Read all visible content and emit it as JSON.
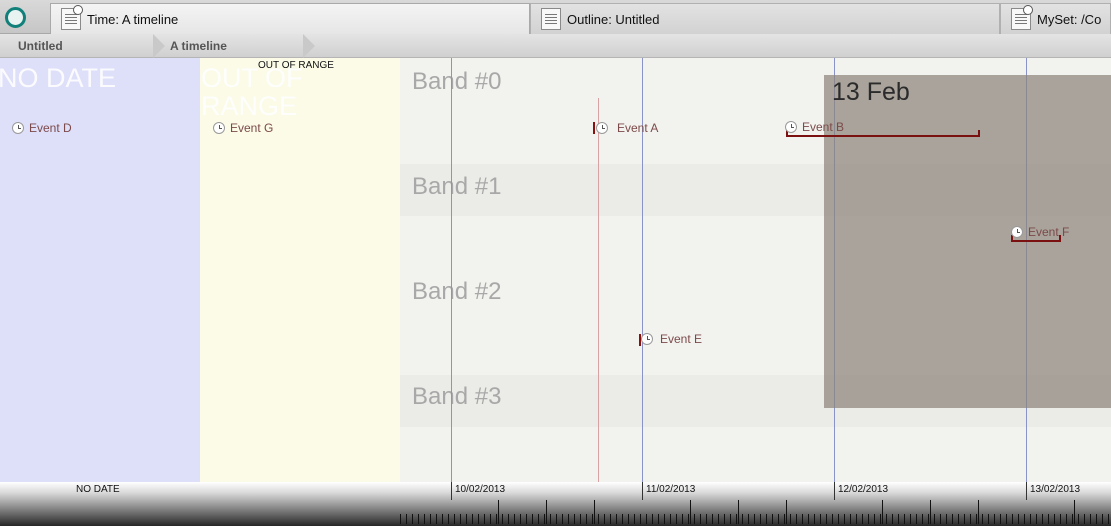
{
  "tabs": [
    {
      "label": "Time: A timeline",
      "active": true
    },
    {
      "label": "Outline: Untitled",
      "active": false
    },
    {
      "label": "MySet: /Co",
      "active": false
    }
  ],
  "breadcrumb": [
    "Untitled",
    "A timeline"
  ],
  "areas": {
    "no_date": "NO DATE",
    "out_of_range_big": "OUT OF RANGE",
    "out_of_range_small": "OUT OF RANGE"
  },
  "bands": [
    "Band #0",
    "Band #1",
    "Band #2",
    "Band #3"
  ],
  "highlight": {
    "label": "13 Feb"
  },
  "events": [
    {
      "label": "Event D",
      "area": "no-date"
    },
    {
      "label": "Event G",
      "area": "out-of-range"
    },
    {
      "label": "Event A",
      "band": 0
    },
    {
      "label": "Event B",
      "band": 0
    },
    {
      "label": "Event F",
      "band": 1
    },
    {
      "label": "Event E",
      "band": 2
    }
  ],
  "ruler": {
    "no_date_label": "NO DATE",
    "dates": [
      "10/02/2013",
      "11/02/2013",
      "12/02/2013",
      "13/02/2013"
    ]
  },
  "colors": {
    "no_date_bg": "#dedff9",
    "out_of_range_bg": "#fbfbe8",
    "event_text": "#7c4a4a",
    "event_marker": "#8a1010",
    "highlight": "#8c847c",
    "gridline": "#8a93c9",
    "home_ring": "#12807a"
  }
}
